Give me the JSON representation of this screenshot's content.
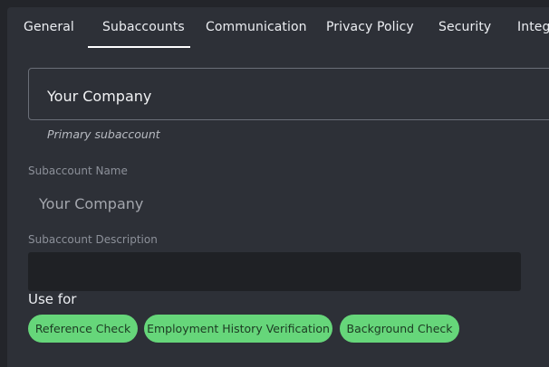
{
  "tabs": [
    {
      "label": "General"
    },
    {
      "label": "Subaccounts"
    },
    {
      "label": "Communication"
    },
    {
      "label": "Privacy Policy"
    },
    {
      "label": "Security"
    },
    {
      "label": "Integ"
    }
  ],
  "active_tab": "Subaccounts",
  "subaccount_card": {
    "name": "Your Company",
    "caption": "Primary subaccount"
  },
  "form": {
    "name_label": "Subaccount Name",
    "name_value": "Your Company",
    "description_label": "Subaccount Description",
    "description_value": ""
  },
  "use_for": {
    "label": "Use for",
    "chips": [
      {
        "label": "Reference Check"
      },
      {
        "label": "Employment History Verification"
      },
      {
        "label": "Background Check"
      }
    ]
  },
  "colors": {
    "page_bg": "#23252a",
    "panel_bg": "#2d3037",
    "chip_bg": "#66d67a",
    "tab_underline": "#ffffff"
  }
}
